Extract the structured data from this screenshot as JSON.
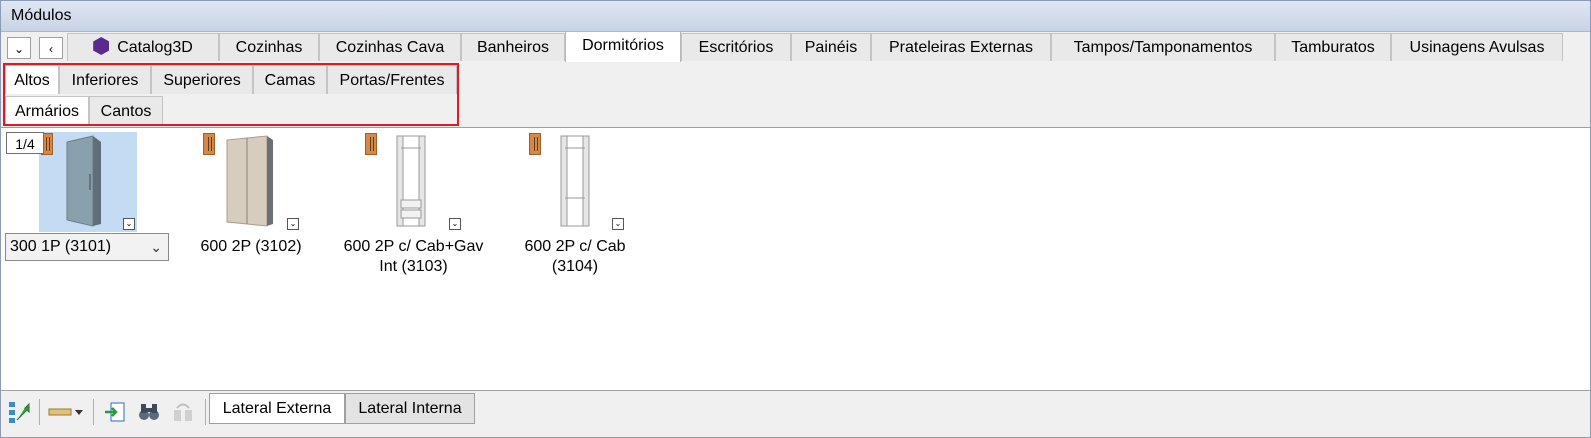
{
  "window": {
    "title": "Módulos"
  },
  "nav": {
    "down_glyph": "⌄",
    "left_glyph": "‹"
  },
  "top_tabs": [
    {
      "label": "Catalog3D",
      "icon": "cube-icon"
    },
    {
      "label": "Cozinhas"
    },
    {
      "label": "Cozinhas Cava"
    },
    {
      "label": "Banheiros"
    },
    {
      "label": "Dormitórios",
      "active": true
    },
    {
      "label": "Escritórios"
    },
    {
      "label": "Painéis"
    },
    {
      "label": "Prateleiras Externas"
    },
    {
      "label": "Tampos/Tamponamentos"
    },
    {
      "label": "Tamburatos"
    },
    {
      "label": "Usinagens Avulsas"
    }
  ],
  "sub_tabs_row1": [
    {
      "label": "Altos",
      "active": true
    },
    {
      "label": "Inferiores"
    },
    {
      "label": "Superiores"
    },
    {
      "label": "Camas"
    },
    {
      "label": "Portas/Frentes"
    }
  ],
  "sub_tabs_row2": [
    {
      "label": "Armários",
      "active": true
    },
    {
      "label": "Cantos"
    }
  ],
  "pager": {
    "text": "1/4"
  },
  "items": [
    {
      "label": "300 1P (3101)",
      "selected": true
    },
    {
      "label": "600 2P (3102)"
    },
    {
      "label": "600 2P c/ Cab+Gav\nInt  (3103)"
    },
    {
      "label": "600 2P c/ Cab\n(3104)"
    }
  ],
  "bottom_tabs": [
    {
      "label": "Lateral Externa",
      "active": true
    },
    {
      "label": "Lateral Interna"
    }
  ],
  "colors": {
    "highlight": "#e01a1f",
    "selection": "#c3dcf3",
    "door_badge": "#d2894a",
    "cube": "#5b2a91"
  }
}
